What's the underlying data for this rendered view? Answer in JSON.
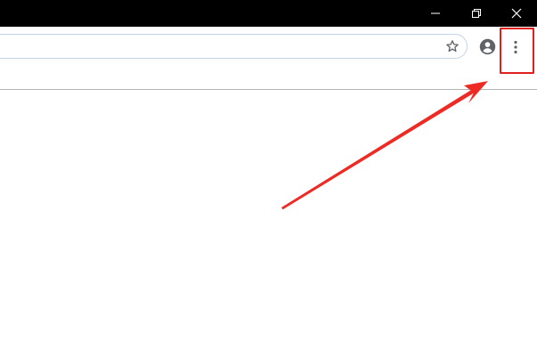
{
  "window": {
    "minimize_icon": "minimize-icon",
    "restore_icon": "restore-icon",
    "close_icon": "close-icon"
  },
  "toolbar": {
    "address_value": "",
    "bookmark_icon": "star-icon",
    "profile_icon": "account-circle-icon",
    "menu_icon": "three-dot-vertical-icon"
  },
  "annotation": {
    "highlight_color": "#e0201c",
    "arrow_color": "#ee2a24",
    "target": "customize-menu-button"
  },
  "colors": {
    "titlebar": "#000000",
    "omnibox_border": "#c6d2e6",
    "icon_gray": "#5f6368",
    "divider": "#b5b5b5"
  }
}
